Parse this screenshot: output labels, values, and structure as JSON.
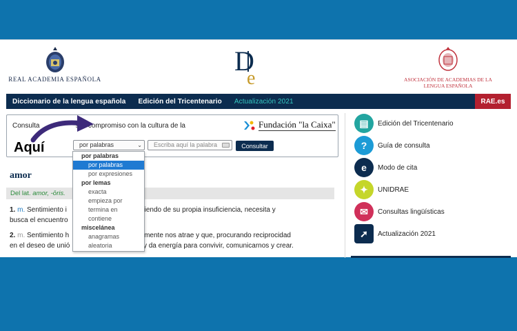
{
  "header": {
    "rae_logo_text": "REAL ACADEMIA ESPAÑOLA",
    "asale_line1": "ASOCIACIÓN DE ACADEMIAS DE LA",
    "asale_line2": "LENGUA ESPAÑOLA"
  },
  "nav": {
    "items": [
      "Diccionario de la lengua española",
      "Edición del Tricentenario",
      "Actualización 2021"
    ],
    "rae": "RAE.es"
  },
  "search": {
    "consulta_start": "Consulta",
    "consulta_end": "s al compromiso con la cultura de la",
    "sponsor": "Fundación \"la Caixa\"",
    "select_value": "por palabras",
    "input_placeholder": "Escriba aquí la palabra",
    "button": "Consultar"
  },
  "annotation": {
    "label": "Aquí"
  },
  "dropdown": {
    "rows": [
      {
        "kind": "group",
        "text": "por palabras"
      },
      {
        "kind": "opt",
        "text": "por palabras",
        "selected": true
      },
      {
        "kind": "opt",
        "text": "por expresiones"
      },
      {
        "kind": "group",
        "text": "por lemas"
      },
      {
        "kind": "opt",
        "text": "exacta"
      },
      {
        "kind": "opt",
        "text": "empieza por"
      },
      {
        "kind": "opt",
        "text": "termina en"
      },
      {
        "kind": "opt",
        "text": "contiene"
      },
      {
        "kind": "group",
        "text": "miscelánea"
      },
      {
        "kind": "opt",
        "text": "anagramas"
      },
      {
        "kind": "opt",
        "text": "aleatoria"
      }
    ]
  },
  "entry": {
    "word": "amor",
    "etym_prefix": "Del lat.",
    "etym_word": "amor, -ōris.",
    "defs": [
      {
        "num": "1.",
        "abbr": "m.",
        "line1_a": "Sentimiento i",
        "line1_b": "o que, partiendo de su propia insuficiencia, necesita y",
        "line2": "busca el encuentro"
      },
      {
        "num": "2.",
        "abbr": "m.",
        "line1_a": "Sentimiento h",
        "line1_b": "e naturalmente nos atrae y que, procurando reciprocidad",
        "line2_a": "en el deseo de unió",
        "line2_b": "ra y da energía para convivir, comunicarnos y crear."
      }
    ]
  },
  "sidebar": {
    "items": [
      {
        "label": "Edición del Tricentenario",
        "color": "#23a5a0",
        "glyph": "▤"
      },
      {
        "label": "Guía de consulta",
        "color": "#1c9bd6",
        "glyph": "?"
      },
      {
        "label": "Modo de cita",
        "color": "#0c2c4f",
        "glyph": "e"
      },
      {
        "label": "UNIDRAE",
        "color": "#c5d62a",
        "glyph": "✦"
      },
      {
        "label": "Consultas lingüísticas",
        "color": "#d0305a",
        "glyph": "✉"
      },
      {
        "label": "Actualización 2021",
        "color": "#0c2c4f",
        "glyph": "➚"
      }
    ]
  },
  "colors": {
    "background": "#0e73ad",
    "navbar": "#0c2c4f",
    "accent_teal": "#35c7c1",
    "rae_red": "#b3202f",
    "etym_green": "#2a8a3a"
  }
}
